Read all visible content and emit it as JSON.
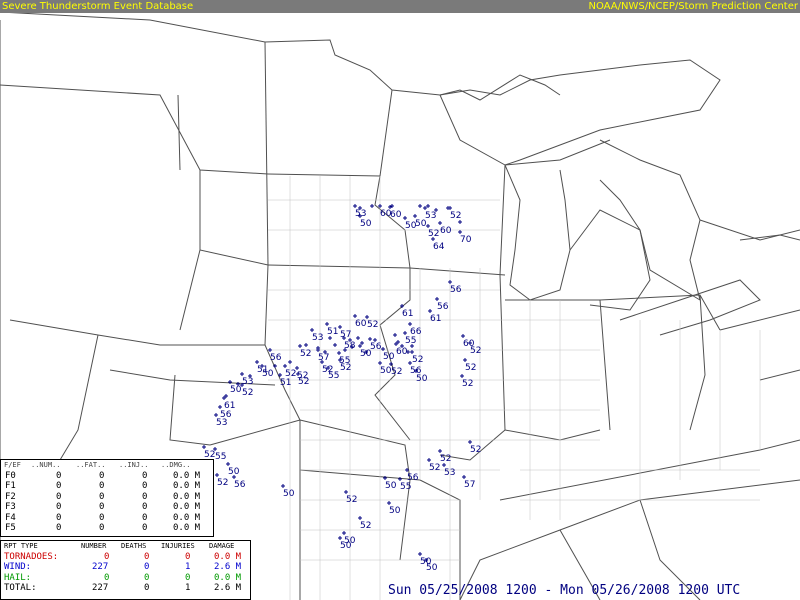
{
  "header": {
    "left_title": "Severe Thunderstorm Event Database",
    "right_title": "NOAA/NWS/NCEP/Storm Prediction Center"
  },
  "colors": {
    "header_bg": "#7a7a7a",
    "header_text": "#ffff00",
    "report_markers": "#000080",
    "tornado": "#cc0000",
    "wind": "#0000cc",
    "hail": "#009900",
    "state_borders": "#505050",
    "county_borders": "#b0b0b0"
  },
  "fscale_table": {
    "headers": [
      "F/EF",
      "..NUM..",
      "..FAT..",
      "..INJ..",
      "..DMG.."
    ],
    "rows": [
      {
        "label": "F0",
        "num": "0",
        "fat": "0",
        "inj": "0",
        "dmg": "0.0 M"
      },
      {
        "label": "F1",
        "num": "0",
        "fat": "0",
        "inj": "0",
        "dmg": "0.0 M"
      },
      {
        "label": "F2",
        "num": "0",
        "fat": "0",
        "inj": "0",
        "dmg": "0.0 M"
      },
      {
        "label": "F3",
        "num": "0",
        "fat": "0",
        "inj": "0",
        "dmg": "0.0 M"
      },
      {
        "label": "F4",
        "num": "0",
        "fat": "0",
        "inj": "0",
        "dmg": "0.0 M"
      },
      {
        "label": "F5",
        "num": "0",
        "fat": "0",
        "inj": "0",
        "dmg": "0.0 M"
      }
    ]
  },
  "summary_table": {
    "headers": [
      "RPT TYPE",
      "NUMBER",
      "DEATHS",
      "INJURIES",
      "DAMAGE"
    ],
    "rows": [
      {
        "type": "TORNADOES:",
        "number": "0",
        "deaths": "0",
        "injuries": "0",
        "damage": "0.0 M"
      },
      {
        "type": "WIND:",
        "number": "227",
        "deaths": "0",
        "injuries": "1",
        "damage": "2.6 M"
      },
      {
        "type": "HAIL:",
        "number": "0",
        "deaths": "0",
        "injuries": "0",
        "damage": "0.0 M"
      },
      {
        "type": "TOTAL:",
        "number": "227",
        "deaths": "0",
        "injuries": "1",
        "damage": "2.6 M"
      }
    ]
  },
  "date_range": "Sun 05/25/2008 1200 - Mon 05/26/2008 1200 UTC",
  "reports": {
    "labels": [
      "53",
      "50",
      "60",
      "60",
      "50",
      "52",
      "53",
      "50",
      "60",
      "52",
      "64",
      "70",
      "56",
      "56",
      "61",
      "61",
      "66",
      "60",
      "52",
      "57",
      "51",
      "53",
      "58",
      "56",
      "50",
      "60",
      "52",
      "55",
      "50",
      "56",
      "52",
      "57",
      "55",
      "52",
      "51",
      "50",
      "52",
      "51",
      "52",
      "52",
      "52",
      "55",
      "50",
      "52",
      "56",
      "50",
      "60",
      "52",
      "52",
      "52",
      "53",
      "50",
      "52",
      "61",
      "53",
      "56",
      "52",
      "55",
      "50",
      "56",
      "52",
      "52",
      "52",
      "52",
      "53",
      "50",
      "52",
      "50",
      "50",
      "55",
      "56",
      "57",
      "52",
      "50",
      "50",
      "50",
      "50"
    ],
    "approx_count_shown": 227
  }
}
